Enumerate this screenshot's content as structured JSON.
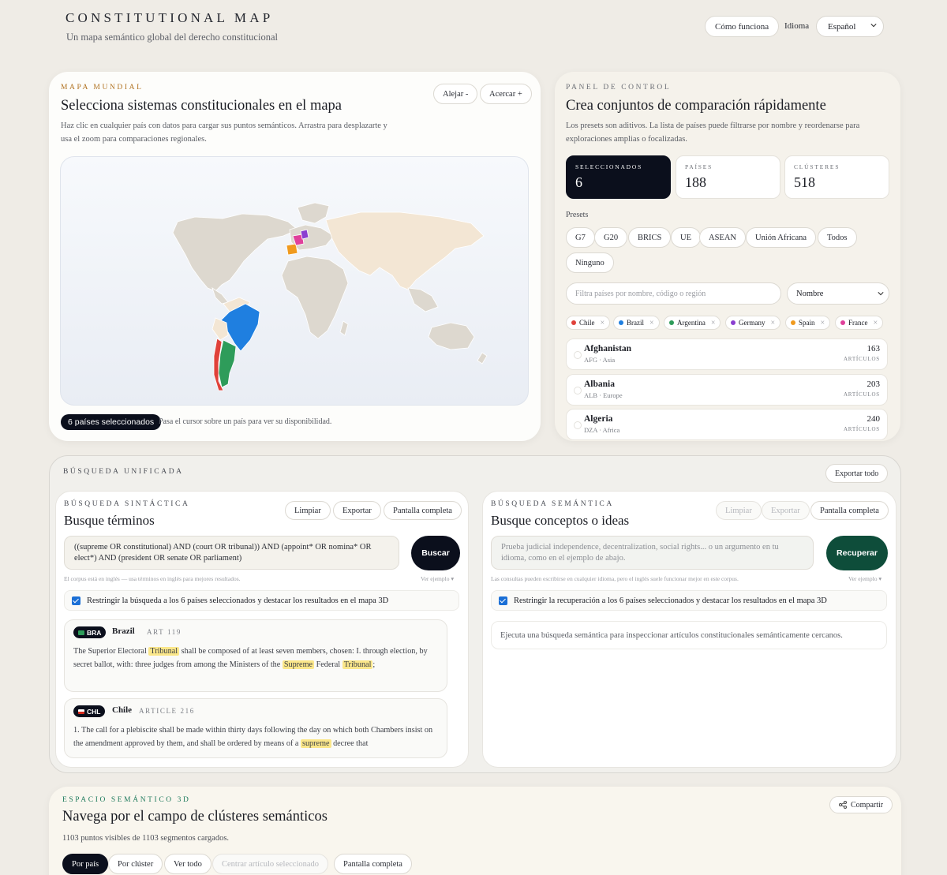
{
  "header": {
    "brand": "CONSTITUTIONAL MAP",
    "tagline": "Un mapa semántico global del derecho constitucional",
    "how_it_works": "Cómo funciona",
    "language_label": "Idioma",
    "language_value": "Español"
  },
  "map_card": {
    "eyebrow": "MAPA MUNDIAL",
    "title": "Selecciona sistemas constitucionales en el mapa",
    "description": "Haz clic en cualquier país con datos para cargar sus puntos semánticos. Arrastra para desplazarte y usa el zoom para comparaciones regionales.",
    "zoom_out": "Alejar -",
    "zoom_in": "Acercar +",
    "selected_count": "6 países seleccionados",
    "hover_hint": "Pasa el cursor sobre un país para ver su disponibilidad."
  },
  "control_panel": {
    "eyebrow": "PANEL DE CONTROL",
    "title": "Crea conjuntos de comparación rápidamente",
    "description": "Los presets son aditivos. La lista de países puede filtrarse por nombre y reordenarse para exploraciones amplias o focalizadas.",
    "stats": [
      {
        "label": "SELECCIONADOS",
        "value": "6"
      },
      {
        "label": "PAÍSES",
        "value": "188"
      },
      {
        "label": "CLÚSTERES",
        "value": "518"
      }
    ],
    "presets_label": "Presets",
    "presets": [
      "G7",
      "G20",
      "BRICS",
      "UE",
      "ASEAN",
      "Unión Africana",
      "Todos",
      "Ninguno"
    ],
    "filter_placeholder": "Filtra países por nombre, código o región",
    "sort_value": "Nombre",
    "chips": [
      {
        "name": "Chile",
        "color": "#e0413a"
      },
      {
        "name": "Brazil",
        "color": "#1f7fe0"
      },
      {
        "name": "Argentina",
        "color": "#2e9c5a"
      },
      {
        "name": "Germany",
        "color": "#8b3fd0"
      },
      {
        "name": "Spain",
        "color": "#f09a1e"
      },
      {
        "name": "France",
        "color": "#e0409b"
      }
    ],
    "countries": [
      {
        "name": "Afghanistan",
        "meta": "AFG · Asia",
        "count": "163",
        "unit": "ARTÍCULOS"
      },
      {
        "name": "Albania",
        "meta": "ALB · Europe",
        "count": "203",
        "unit": "ARTÍCULOS"
      },
      {
        "name": "Algeria",
        "meta": "DZA · Africa",
        "count": "240",
        "unit": "ARTÍCULOS"
      }
    ]
  },
  "unified_search": {
    "eyebrow": "BÚSQUEDA UNIFICADA",
    "export_all": "Exportar todo",
    "syntactic": {
      "eyebrow": "BÚSQUEDA SINTÁCTICA",
      "title": "Busque términos",
      "clear": "Limpiar",
      "export": "Exportar",
      "fullscreen": "Pantalla completa",
      "query": "((supreme OR constitutional) AND (court OR tribunal)) AND (appoint* OR nomina* OR elect*) AND (president OR senate OR parliament)",
      "submit": "Buscar",
      "hint": "El corpus está en inglés — usa términos en inglés para mejores resultados.",
      "example": "Ver ejemplo ▾",
      "restrict": "Restringir la búsqueda a los 6 países seleccionados y destacar los resultados en el mapa 3D",
      "results": [
        {
          "code": "BRA",
          "country": "Brazil",
          "article": "ART 119",
          "parts": [
            "The Superior Electoral ",
            "Tribunal",
            " shall be composed of at least seven members, chosen: I. through election, by secret ballot, with: three judges from among the Ministers of the ",
            "Supreme",
            " Federal ",
            "Tribunal",
            ";"
          ]
        },
        {
          "code": "CHL",
          "country": "Chile",
          "article": "ARTICLE 216",
          "parts": [
            "1. The call for a plebiscite shall be made within thirty days following the day on which both Chambers insist on the amendment approved by them, and shall be ordered by means of a ",
            "supreme",
            " decree that"
          ]
        }
      ]
    },
    "semantic": {
      "eyebrow": "BÚSQUEDA SEMÁNTICA",
      "title": "Busque conceptos o ideas",
      "clear": "Limpiar",
      "export": "Exportar",
      "fullscreen": "Pantalla completa",
      "placeholder": "Prueba judicial independence, decentralization, social rights... o un argumento en tu idioma, como en el ejemplo de abajo.",
      "submit": "Recuperar",
      "hint": "Las consultas pueden escribirse en cualquier idioma, pero el inglés suele funcionar mejor en este corpus.",
      "example": "Ver ejemplo ▾",
      "restrict": "Restringir la recuperación a los 6 países seleccionados y destacar los resultados en el mapa 3D",
      "empty": "Ejecuta una búsqueda semántica para inspeccionar artículos constitucionales semánticamente cercanos."
    }
  },
  "semantic_space": {
    "eyebrow": "ESPACIO SEMÁNTICO 3D",
    "title": "Navega por el campo de clústeres semánticos",
    "description": "1103 puntos visibles de 1103 segmentos cargados.",
    "share": "Compartir",
    "buttons": [
      "Por país",
      "Por clúster",
      "Ver todo",
      "Centrar artículo seleccionado",
      "Pantalla completa"
    ]
  }
}
